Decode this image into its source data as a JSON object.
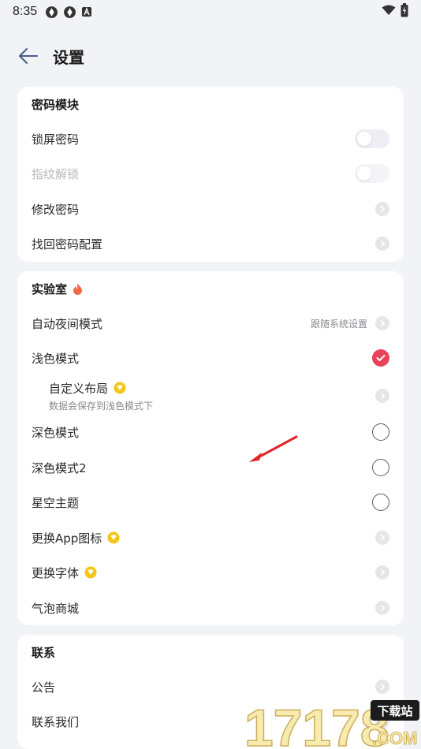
{
  "status_bar": {
    "time": "8:35"
  },
  "header": {
    "title": "设置"
  },
  "sections": {
    "password": {
      "title": "密码模块",
      "lock_screen": "锁屏密码",
      "fingerprint": "指纹解锁",
      "change_password": "修改密码",
      "recover_config": "找回密码配置"
    },
    "lab": {
      "title": "实验室",
      "auto_night": "自动夜间模式",
      "auto_night_value": "跟随系统设置",
      "light_mode": "浅色模式",
      "custom_layout": "自定义布局",
      "custom_layout_desc": "数据会保存到浅色模式下",
      "dark_mode": "深色模式",
      "dark_mode_2": "深色模式2",
      "starry_theme": "星空主题",
      "change_app_icon": "更换App图标",
      "change_font": "更换字体",
      "bubble_store": "气泡商城"
    },
    "contact": {
      "title": "联系",
      "announcement": "公告",
      "contact_us": "联系我们"
    }
  },
  "watermark": {
    "text": "17178",
    "badge": "下载站",
    "suffix": ".COM"
  },
  "colors": {
    "accent": "#e8435a",
    "background": "#f2f3f7",
    "card": "#ffffff",
    "gold": "#f5c518"
  }
}
